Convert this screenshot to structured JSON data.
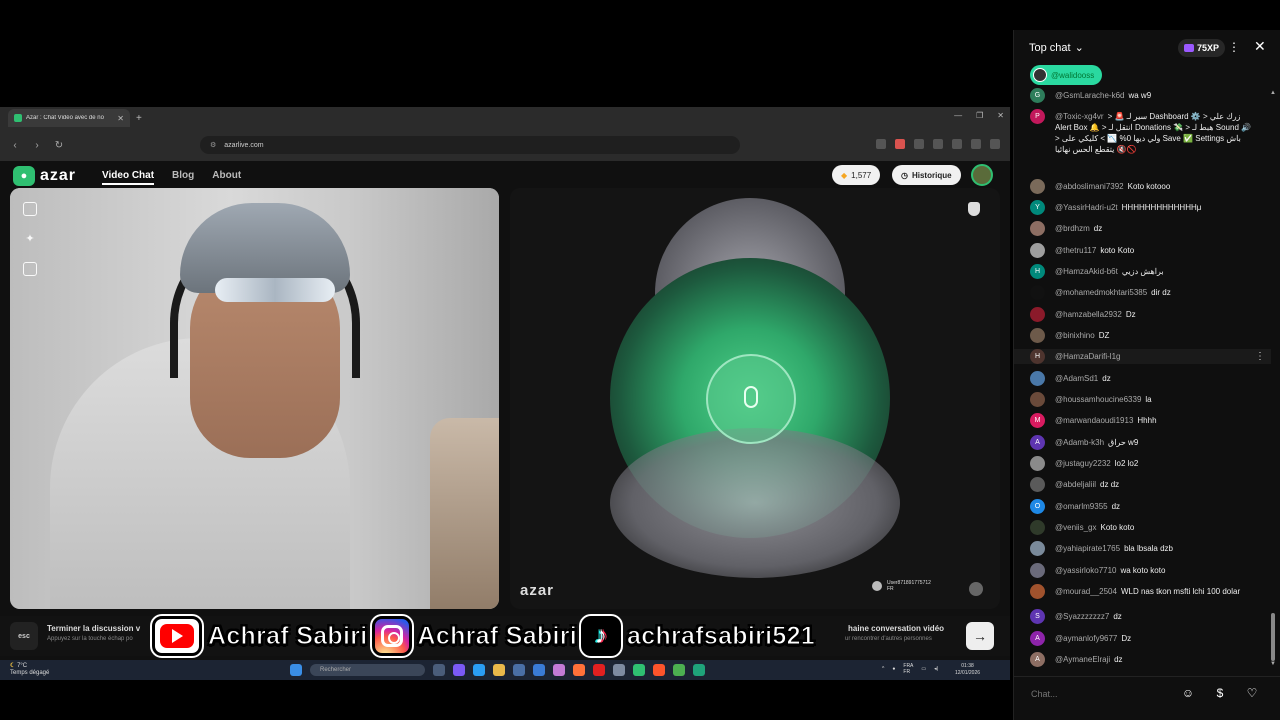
{
  "browser": {
    "tab_title": "Azar : Chat Vidéo avec de no",
    "url": "azarlive.com"
  },
  "azar": {
    "logo": "azar",
    "nav": [
      "Video Chat",
      "Blog",
      "About"
    ],
    "coins": "1,577",
    "history_label": "Historique",
    "watermark": "azar",
    "remote_user": "User871891775712",
    "remote_country": "FR",
    "esc_label": "esc",
    "end_title": "Terminer la discussion v",
    "end_sub": "Appuyez sur la touche échap po",
    "next_title": "haine conversation vidéo",
    "next_sub": "ur rencontrer d'autres personnes",
    "next_arrow": "→"
  },
  "taskbar": {
    "temp": "7°C",
    "weather": "Temps dégagé",
    "search": "Rechercher",
    "lang": "FRA",
    "lang2": "FR",
    "time": "01:38",
    "date": "12/01/2026"
  },
  "overlay": {
    "youtube": "Achraf Sabiri",
    "instagram": "Achraf Sabiri",
    "tiktok": "achrafsabiri521"
  },
  "chat": {
    "title": "Top chat",
    "xp": "75XP",
    "pinned_user": "@walidooss",
    "input_placeholder": "Chat...",
    "messages": [
      {
        "author": "@GsmLarache-k6d",
        "text": "wa w9",
        "avatar_letter": "G",
        "avatar_color": "#2e7d5b"
      },
      {
        "author": "@Toxic-xg4vr",
        "text": "> 🚨 سير لـ Dashboard ⚙️ > زرك علي Alert Box 🔔 > انتقل لـ Donations 💸 > هبط لـ Sound 🔊 > ولي ديها 0% 📉 > كليكي على Save ✅ Settings باش يتقطع الحس نهائيا 🔇🚫",
        "avatar_letter": "P",
        "avatar_color": "#c2185b"
      },
      {
        "author": "@abdoslimani7392",
        "text": "Koto kotooo",
        "avatar_letter": "",
        "avatar_color": "#7a6a5a"
      },
      {
        "author": "@YassirHadri-u2t",
        "text": "HHHHHHHHHHHHHμ",
        "avatar_letter": "Y",
        "avatar_color": "#00897b"
      },
      {
        "author": "@brdhzm",
        "text": "dz",
        "avatar_letter": "",
        "avatar_color": "#8d6e63"
      },
      {
        "author": "@thetru117",
        "text": "koto Koto",
        "avatar_letter": "",
        "avatar_color": "#9e9e9e"
      },
      {
        "author": "@HamzaAkid-b6t",
        "text": "براهش دزيي",
        "avatar_letter": "H",
        "avatar_color": "#00897b"
      },
      {
        "author": "@mohamedmokhtari5385",
        "text": "dir dz",
        "avatar_letter": "",
        "avatar_color": "#111111"
      },
      {
        "author": "@hamzabella2932",
        "text": "Dz",
        "avatar_letter": "",
        "avatar_color": "#8b1a2a"
      },
      {
        "author": "@binixhino",
        "text": "DZ",
        "avatar_letter": "",
        "avatar_color": "#6d5a4a"
      },
      {
        "author": "@HamzaDarifi-l1g",
        "text": "",
        "avatar_letter": "H",
        "avatar_color": "#4e342e"
      },
      {
        "author": "@AdamSd1",
        "text": "dz",
        "avatar_letter": "",
        "avatar_color": "#4a78a8"
      },
      {
        "author": "@houssamhoucine6339",
        "text": "la",
        "avatar_letter": "",
        "avatar_color": "#6a4a3a"
      },
      {
        "author": "@marwandaoudi1913",
        "text": "Hhhh",
        "avatar_letter": "M",
        "avatar_color": "#d81b60"
      },
      {
        "author": "@Adamb-k3h",
        "text": "حراق w9",
        "avatar_letter": "A",
        "avatar_color": "#5e35b1"
      },
      {
        "author": "@justaguy2232",
        "text": "lo2 lo2",
        "avatar_letter": "",
        "avatar_color": "#8a8a8a"
      },
      {
        "author": "@abdeljaliil",
        "text": "dz dz",
        "avatar_letter": "",
        "avatar_color": "#5a5a5a"
      },
      {
        "author": "@omarlm9355",
        "text": "dz",
        "avatar_letter": "O",
        "avatar_color": "#1e88e5"
      },
      {
        "author": "@veniis_gx",
        "text": "Koto koto",
        "avatar_letter": "",
        "avatar_color": "#2f3a2a"
      },
      {
        "author": "@yahiapirate1765",
        "text": "bla lbsala dzb",
        "avatar_letter": "",
        "avatar_color": "#7a8a9a"
      },
      {
        "author": "@yassirloko7710",
        "text": "wa koto koto",
        "avatar_letter": "",
        "avatar_color": "#6a6a7a"
      },
      {
        "author": "@mourad__2504",
        "text": "WLD nas tkon msfti lchi 100 dolar",
        "avatar_letter": "",
        "avatar_color": "#a0522d"
      },
      {
        "author": "@Syazzzzzzz7",
        "text": "dz",
        "avatar_letter": "S",
        "avatar_color": "#5e35b1"
      },
      {
        "author": "@aymanlofy9677",
        "text": "Dz",
        "avatar_letter": "A",
        "avatar_color": "#8e24aa"
      },
      {
        "author": "@AymaneElraji",
        "text": "dz",
        "avatar_letter": "A",
        "avatar_color": "#8d6e63"
      }
    ]
  }
}
